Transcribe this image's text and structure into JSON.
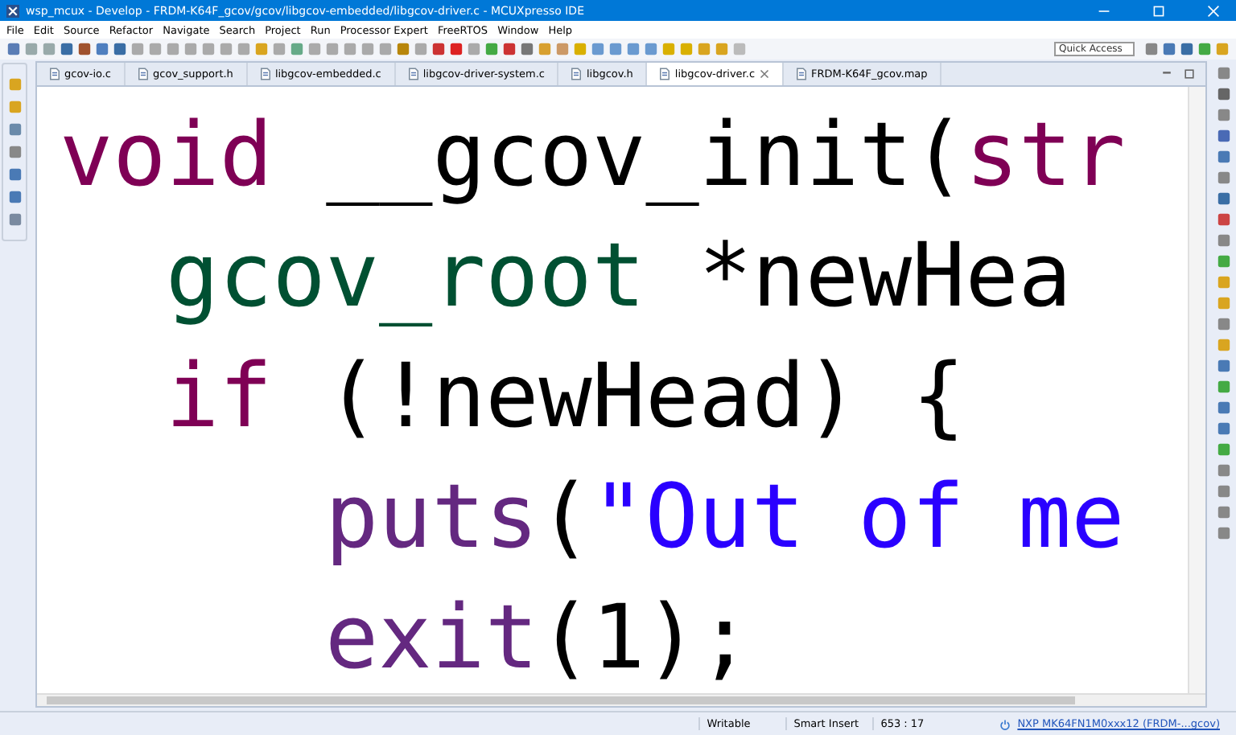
{
  "window": {
    "title": "wsp_mcux - Develop - FRDM-K64F_gcov/gcov/libgcov-embedded/libgcov-driver.c - MCUXpresso IDE"
  },
  "menu": [
    "File",
    "Edit",
    "Source",
    "Refactor",
    "Navigate",
    "Search",
    "Project",
    "Run",
    "Processor Expert",
    "FreeRTOS",
    "Window",
    "Help"
  ],
  "quick_access": {
    "placeholder": "Quick Access"
  },
  "tabs": [
    {
      "label": "gcov-io.c",
      "selected": false
    },
    {
      "label": "gcov_support.h",
      "selected": false
    },
    {
      "label": "libgcov-embedded.c",
      "selected": false
    },
    {
      "label": "libgcov-driver-system.c",
      "selected": false
    },
    {
      "label": "libgcov.h",
      "selected": false
    },
    {
      "label": "libgcov-driver.c",
      "selected": true
    },
    {
      "label": "FRDM-K64F_gcov.map",
      "selected": false
    }
  ],
  "code_lines": [
    {
      "tokens": [
        {
          "text": "void",
          "kind": "keyword"
        },
        {
          "text": " __gcov_init(",
          "kind": "plain"
        },
        {
          "text": "str",
          "kind": "keyword"
        }
      ],
      "children": [
        {
          "tokens": [
            {
              "text": "gcov_root",
              "kind": "type"
            },
            {
              "text": " *newHea",
              "kind": "plain"
            }
          ]
        },
        {
          "tokens": [
            {
              "text": "if",
              "kind": "keyword"
            },
            {
              "text": " (!newHead) {",
              "kind": "plain"
            }
          ],
          "children": [
            {
              "tokens": [
                {
                  "text": "puts",
                  "kind": "function"
                },
                {
                  "text": "(",
                  "kind": "plain"
                },
                {
                  "text": "\"Out of me",
                  "kind": "string"
                }
              ]
            },
            {
              "tokens": [
                {
                  "text": "exit",
                  "kind": "function"
                },
                {
                  "text": "(1);",
                  "kind": "plain"
                }
              ]
            }
          ]
        }
      ]
    }
  ],
  "status_bar": {
    "mode": "Writable",
    "insert": "Smart Insert",
    "position": "653 : 17",
    "target": "NXP MK64FN1M0xxx12 (FRDM-...gcov)"
  }
}
